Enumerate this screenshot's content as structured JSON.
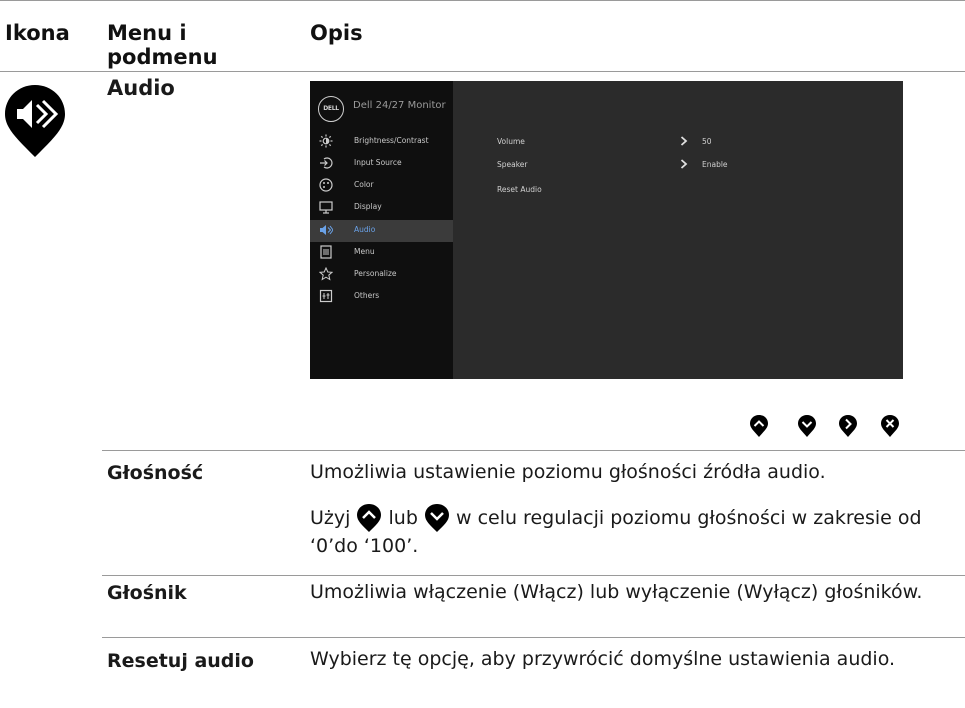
{
  "header": {
    "col1": "Ikona",
    "col2_line1": "Menu i",
    "col2_line2": "podmenu",
    "col3": "Opis"
  },
  "section": {
    "title": "Audio",
    "icon": "speaker-pin-icon"
  },
  "osd": {
    "brand": "DELL",
    "title": "Dell 24/27 Monitor",
    "menu": [
      {
        "label": "Brightness/Contrast",
        "icon": "brightness-icon"
      },
      {
        "label": "Input Source",
        "icon": "input-source-icon"
      },
      {
        "label": "Color",
        "icon": "color-icon"
      },
      {
        "label": "Display",
        "icon": "display-icon"
      },
      {
        "label": "Audio",
        "icon": "audio-icon",
        "active": true
      },
      {
        "label": "Menu",
        "icon": "menu-icon"
      },
      {
        "label": "Personalize",
        "icon": "star-icon"
      },
      {
        "label": "Others",
        "icon": "others-icon"
      }
    ],
    "options": [
      {
        "label": "Volume",
        "value": "50"
      },
      {
        "label": "Speaker",
        "value": "Enable"
      },
      {
        "label": "Reset Audio",
        "value": ""
      }
    ],
    "accent_color": "#6aa2e8"
  },
  "nav_buttons": [
    "up-icon",
    "down-icon",
    "right-icon",
    "close-icon"
  ],
  "rows": [
    {
      "label": "Głośność",
      "text1": "Umożliwia ustawienie poziomu głośności źródła audio.",
      "text2a": "Użyj",
      "text2b": "lub",
      "text2c": "w celu regulacji poziomu głośności w zakresie od ‘0’do ‘100’."
    },
    {
      "label": "Głośnik",
      "text": "Umożliwia włączenie (Włącz) lub wyłączenie (Wyłącz) głośników."
    },
    {
      "label": "Resetuj audio",
      "text": "Wybierz tę opcję, aby przywrócić domyślne ustawienia audio."
    }
  ]
}
